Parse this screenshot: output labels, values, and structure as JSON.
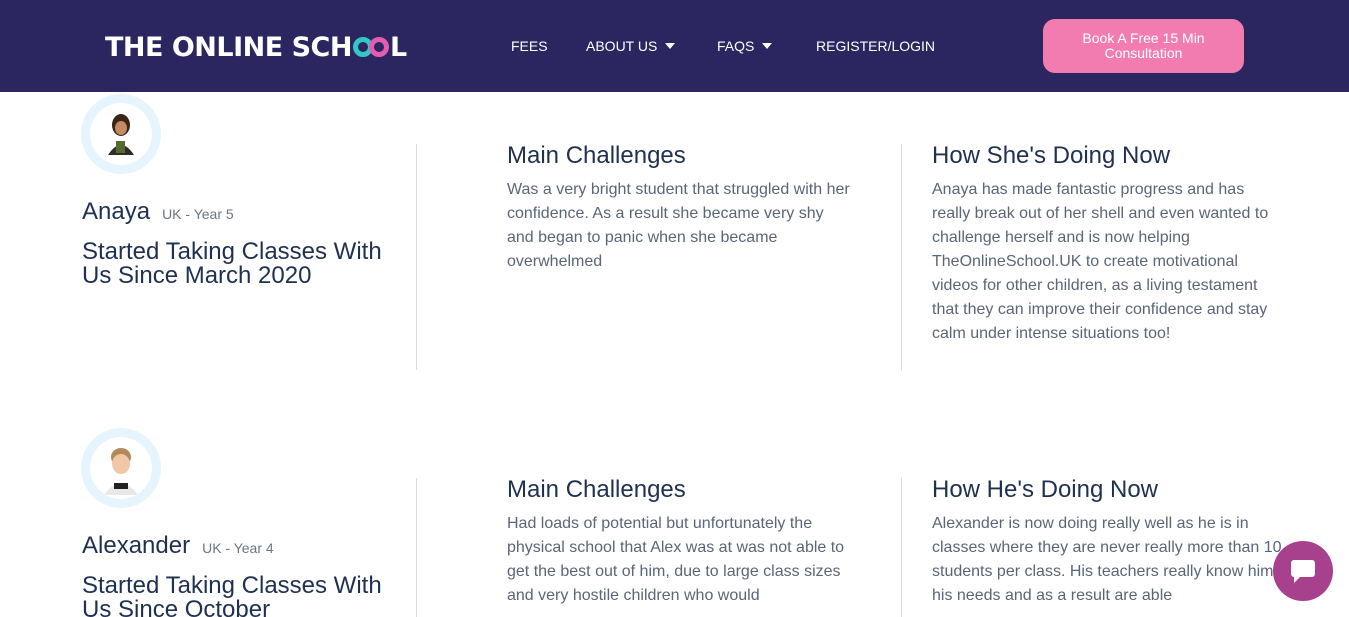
{
  "header": {
    "logo": {
      "prefix": "THE ONLINE SCH",
      "suffix": "L"
    },
    "nav": {
      "fees": "FEES",
      "about": "ABOUT US",
      "faqs": "FAQS",
      "register": "REGISTER/LOGIN"
    },
    "cta_label": "Book A Free 15 Min Consultation"
  },
  "students": [
    {
      "name": "Anaya",
      "meta": "UK - Year 5",
      "since": "Started Taking Classes With Us Since March 2020",
      "challenges_title": "Main Challenges",
      "challenges_text": "Was a very bright student that struggled with her confidence. As a result she became very shy and began to panic when she became overwhelmed",
      "progress_title": "How She's Doing Now",
      "progress_text": "Anaya has made fantastic progress and has really break out of her shell and even wanted to challenge herself and is now helping TheOnlineSchool.UK to create motivational videos for other children, as a living testament that they can improve their confidence and stay calm under intense situations too!"
    },
    {
      "name": "Alexander",
      "meta": "UK - Year 4",
      "since": "Started Taking Classes With Us Since October",
      "challenges_title": "Main Challenges",
      "challenges_text": "Had loads of potential but unfortunately the physical school that Alex was at was not able to get the best out of him, due to large class sizes and very hostile children who would",
      "progress_title": "How He's Doing Now",
      "progress_text": "Alexander is now doing really well as he is in classes where they are never really more than 10 students per class. His teachers really know him, his needs and as a result are able"
    }
  ],
  "colors": {
    "header_bg": "#2b2560",
    "cta_bg": "#f27cb0",
    "chat_bg": "#a8418d"
  },
  "icons": {
    "chat": "chat-bubble-icon",
    "caret": "caret-down-icon"
  }
}
